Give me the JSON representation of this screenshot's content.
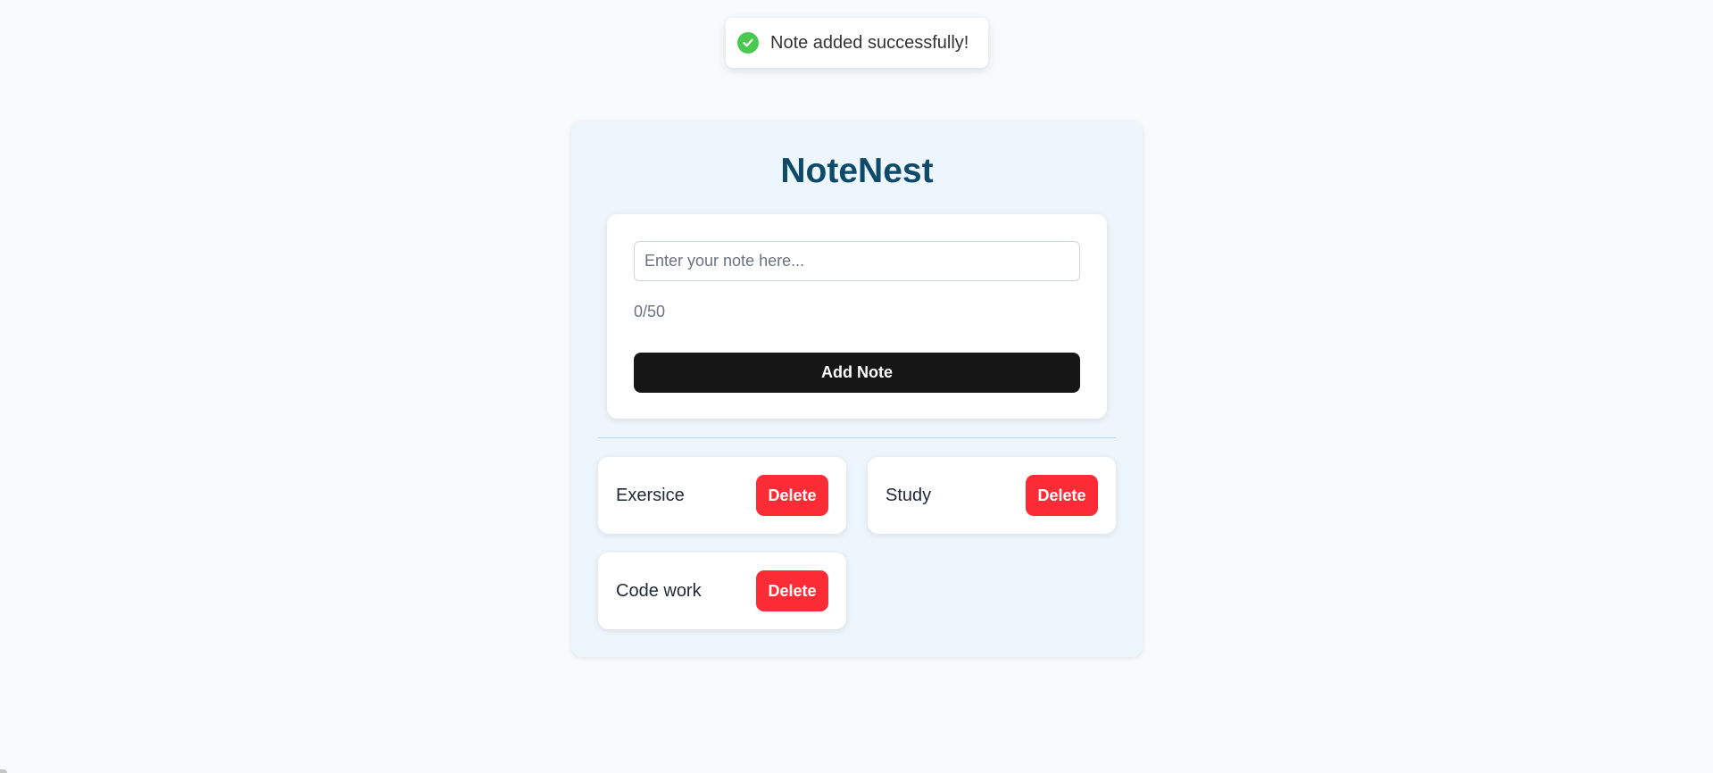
{
  "toast": {
    "message": "Note added successfully!",
    "icon": "check-circle-icon",
    "color": "#4ac850"
  },
  "app": {
    "title": "NoteNest",
    "title_color": "#0e4b6b"
  },
  "form": {
    "input_value": "",
    "placeholder": "Enter your note here...",
    "char_count": "0/50",
    "add_label": "Add Note"
  },
  "notes": [
    {
      "text": "Exersice",
      "delete_label": "Delete"
    },
    {
      "text": "Study",
      "delete_label": "Delete"
    },
    {
      "text": "Code work",
      "delete_label": "Delete"
    }
  ],
  "colors": {
    "delete": "#fb2c36",
    "add_button": "#161616",
    "panel_bg": "#eef6fd",
    "page_bg": "#f8fafc"
  }
}
